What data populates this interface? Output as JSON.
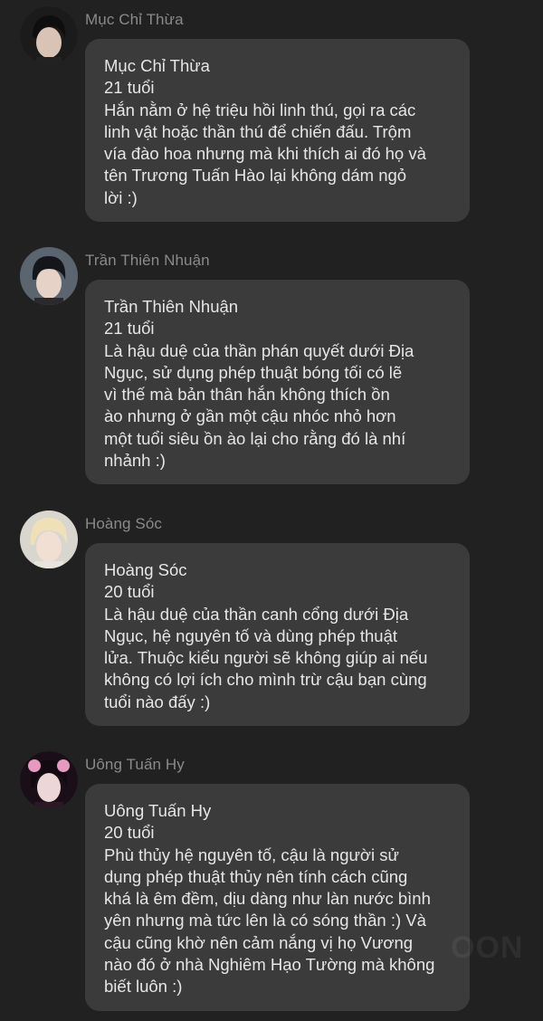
{
  "posts": [
    {
      "author": "Mục Chỉ Thừa",
      "bubble": {
        "name": "Mục Chỉ Thừa",
        "age": "21 tuổi",
        "desc": "Hắn nằm ở hệ triệu hồi linh thú, gọi ra các\nlinh vật hoặc thần thú để chiến đấu. Trộm\nvía đào hoa nhưng mà khi thích ai đó họ và\ntên Trương Tuấn Hào lại không dám ngỏ\nlời :)"
      },
      "avatar_icon": "avatar-dark-hair-icon"
    },
    {
      "author": "Trần Thiên Nhuận",
      "bubble": {
        "name": "Trần Thiên Nhuận",
        "age": "21 tuổi",
        "desc": "Là hậu duệ của thần phán quyết dưới Địa\nNgục, sử dụng phép thuật bóng tối có lẽ\nvì thế mà bản thân hắn không thích ồn\nào nhưng ở gần một cậu nhóc nhỏ hơn\nmột tuổi siêu ồn ào lại cho rằng đó là nhí\nnhảnh :)"
      },
      "avatar_icon": "avatar-dark-hair-icon"
    },
    {
      "author": "Hoàng Sóc",
      "bubble": {
        "name": "Hoàng Sóc",
        "age": "20 tuổi",
        "desc": "Là hậu duệ của thần canh cổng dưới Địa\nNgục, hệ nguyên tố và dùng phép thuật\nlửa. Thuộc kiểu người sẽ không giúp ai nếu\nkhông có lợi ích cho mình trừ cậu bạn cùng\ntuổi nào đấy :)"
      },
      "avatar_icon": "avatar-blonde-hair-icon"
    },
    {
      "author": "Uông Tuấn Hy",
      "bubble": {
        "name": "Uông Tuấn Hy",
        "age": "20 tuổi",
        "desc": "Phù thủy hệ nguyên tố, cậu là người sử\ndụng phép thuật thủy nên tính cách cũng\nkhá là êm đềm, dịu dàng như làn nước bình\nyên nhưng mà tức lên là có sóng thần :) Và\ncậu cũng khờ nên cảm nắng vị họ Vương\nnào đó ở nhà Nghiêm Hạo Tường mà không\nbiết luôn :)"
      },
      "avatar_icon": "avatar-pink-hair-icon"
    }
  ],
  "watermark": "OON",
  "colors": {
    "background": "#212121",
    "bubble": "#3b3b3b",
    "author_text": "#8a8a8a",
    "bubble_text": "#e6e6e6"
  }
}
